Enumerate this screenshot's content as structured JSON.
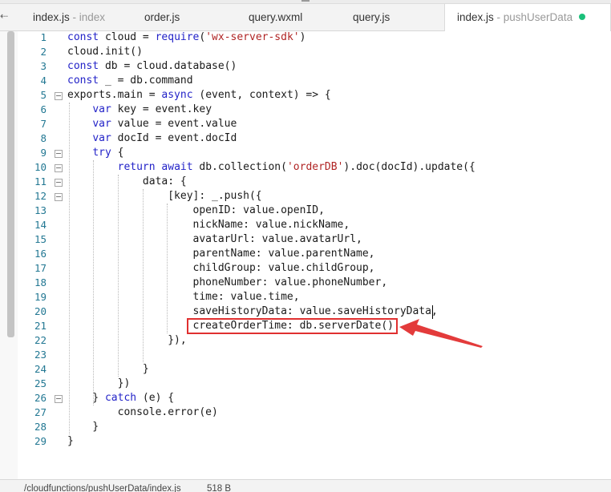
{
  "tabs": [
    {
      "label": "index.js",
      "sub": " - index",
      "active": false
    },
    {
      "label": "order.js",
      "sub": "",
      "active": false
    },
    {
      "label": "query.wxml",
      "sub": "",
      "active": false
    },
    {
      "label": "query.js",
      "sub": "",
      "active": false
    },
    {
      "label": "index.js",
      "sub": " - pushUserData",
      "active": true,
      "modified": true
    }
  ],
  "editor": {
    "lines": [
      {
        "n": "1",
        "code": "const cloud = require('wx-server-sdk')"
      },
      {
        "n": "2",
        "code": "cloud.init()"
      },
      {
        "n": "3",
        "code": "const db = cloud.database()"
      },
      {
        "n": "4",
        "code": "const _ = db.command"
      },
      {
        "n": "5",
        "code": "exports.main = async (event, context) => {"
      },
      {
        "n": "6",
        "code": "    var key = event.key"
      },
      {
        "n": "7",
        "code": "    var value = event.value"
      },
      {
        "n": "8",
        "code": "    var docId = event.docId"
      },
      {
        "n": "9",
        "code": "    try {"
      },
      {
        "n": "10",
        "code": "        return await db.collection('orderDB').doc(docId).update({"
      },
      {
        "n": "11",
        "code": "            data: {"
      },
      {
        "n": "12",
        "code": "                [key]: _.push({"
      },
      {
        "n": "13",
        "code": "                    openID: value.openID,"
      },
      {
        "n": "14",
        "code": "                    nickName: value.nickName,"
      },
      {
        "n": "15",
        "code": "                    avatarUrl: value.avatarUrl,"
      },
      {
        "n": "16",
        "code": "                    parentName: value.parentName,"
      },
      {
        "n": "17",
        "code": "                    childGroup: value.childGroup,"
      },
      {
        "n": "18",
        "code": "                    phoneNumber: value.phoneNumber,"
      },
      {
        "n": "19",
        "code": "                    time: value.time,"
      },
      {
        "n": "20",
        "code": "                    saveHistoryData: value.saveHistoryData,"
      },
      {
        "n": "21",
        "code": "                    createOrderTime: db.serverDate()"
      },
      {
        "n": "22",
        "code": "                }),"
      },
      {
        "n": "23",
        "code": ""
      },
      {
        "n": "24",
        "code": "            }"
      },
      {
        "n": "25",
        "code": "        })"
      },
      {
        "n": "26",
        "code": "    } catch (e) {"
      },
      {
        "n": "27",
        "code": "        console.error(e)"
      },
      {
        "n": "28",
        "code": "    }"
      },
      {
        "n": "29",
        "code": "}"
      }
    ],
    "fold_lines": [
      "5",
      "9",
      "10",
      "11",
      "12",
      "26"
    ],
    "highlight_color": "#e03030"
  },
  "status": {
    "path": "/cloudfunctions/pushUserData/index.js",
    "size": "518 B"
  }
}
